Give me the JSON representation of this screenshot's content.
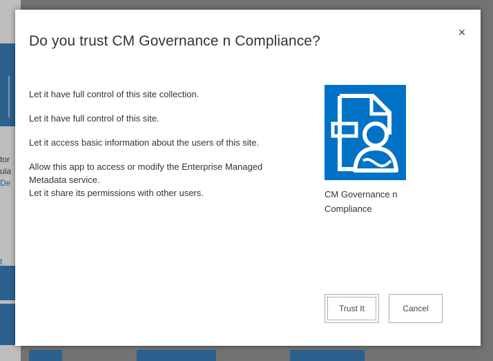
{
  "background": {
    "fragments": [
      "tor",
      "ula",
      "De",
      "t"
    ]
  },
  "dialog": {
    "title": "Do you trust CM Governance n Compliance?",
    "close_glyph": "×",
    "permissions": [
      "Let it have full control of this site collection.",
      "Let it have full control of this site.",
      "Let it access basic information about the users of this site."
    ],
    "permission_group": [
      "Allow this app to access or modify the Enterprise Managed Metadata service.",
      "Let it share its permissions with other users."
    ],
    "app": {
      "name": "CM Governance n Compliance",
      "icon": "document-user-icon",
      "tile_color": "#0072c6"
    },
    "buttons": {
      "trust": "Trust It",
      "cancel": "Cancel"
    }
  },
  "colors": {
    "accent": "#0072c6",
    "text": "#333333"
  }
}
